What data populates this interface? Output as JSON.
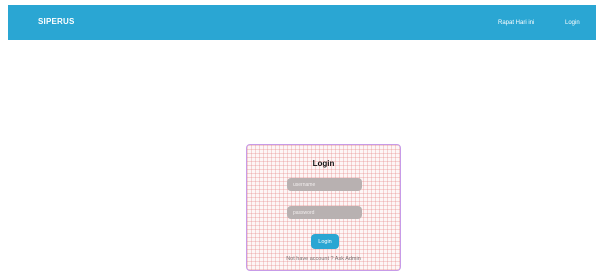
{
  "navbar": {
    "brand": "SIPERUS",
    "links": [
      "Rapat Hari ini",
      "Login"
    ]
  },
  "login_form": {
    "title": "Login",
    "username_placeholder": "username",
    "password_placeholder": "password",
    "submit_label": "Login",
    "footer_text": "Not have account ? Ask Admin"
  },
  "colors": {
    "primary": "#2aa6d3",
    "card_border": "#c79be8",
    "input_bg": "#b8b1b1"
  }
}
